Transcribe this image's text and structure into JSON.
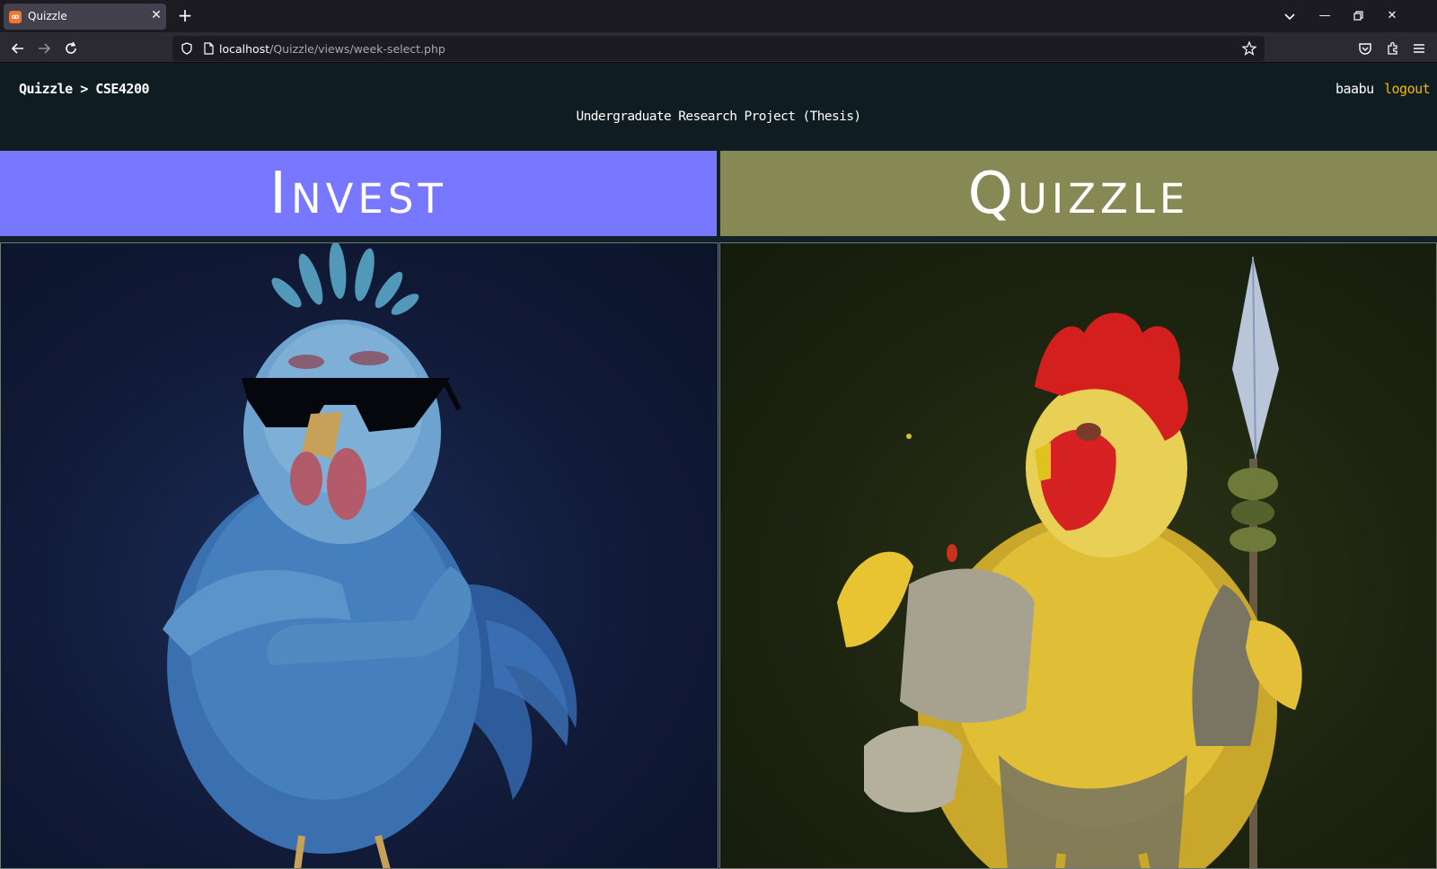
{
  "browser": {
    "tab_title": "Quizzle",
    "tab_favicon": "xampp-icon",
    "url_host": "localhost",
    "url_path": "/Quizzle/views/week-select.php"
  },
  "header": {
    "breadcrumb": "Quizzle > CSE4200",
    "subtitle": "Undergraduate Research Project (Thesis)",
    "username": "baabu",
    "logout_label": "logout"
  },
  "options": [
    {
      "label": "Invest",
      "image": "blue rooster with sunglasses and crossed arms",
      "color": "#7877ff"
    },
    {
      "label": "Quizzle",
      "image": "armored yellow rooster holding a spear",
      "color": "#878955"
    }
  ],
  "colors": {
    "header_bg": "#0f1d22",
    "logout": "#f5b800",
    "invest_banner": "#7877ff",
    "quizzle_banner": "#878955"
  }
}
